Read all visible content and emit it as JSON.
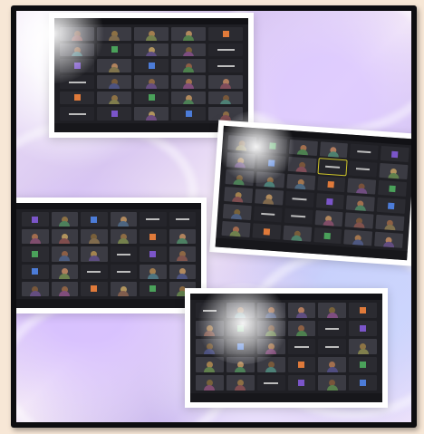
{
  "collage": {
    "screenshots": [
      {
        "id": "top-left",
        "cols": 5,
        "rows": 6
      },
      {
        "id": "top-right",
        "cols": 6,
        "rows": 6
      },
      {
        "id": "middle-left",
        "cols": 6,
        "rows": 5
      },
      {
        "id": "bottom-right",
        "cols": 6,
        "rows": 5
      }
    ]
  },
  "colors": {
    "frame": "#0d0d10",
    "screen": "#1f1f24",
    "accent_blue": "#4c7cd8",
    "accent_purple": "#7b55c9",
    "accent_orange": "#e07a3a",
    "highlight_yellow": "#d0c62a"
  }
}
